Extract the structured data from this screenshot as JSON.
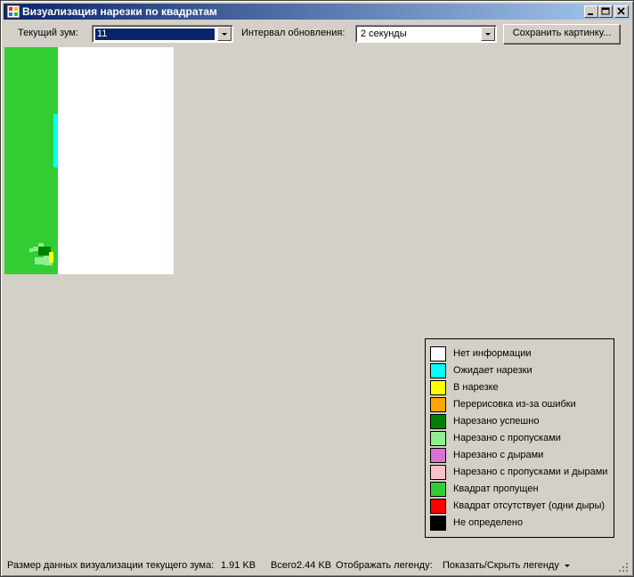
{
  "window": {
    "title": "Визуализация нарезки по квадратам"
  },
  "toolbar": {
    "zoom_label": "Текущий зум:",
    "zoom_value": "11",
    "interval_label": "Интервал обновления:",
    "interval_value": "2 секунды",
    "save_button": "Сохранить картинку..."
  },
  "legend": {
    "items": [
      {
        "label": "Нет информации",
        "color": "#ffffff"
      },
      {
        "label": "Ожидает нарезки",
        "color": "#00ffff"
      },
      {
        "label": "В нарезке",
        "color": "#ffff00"
      },
      {
        "label": "Перерисовка из-за ошибки",
        "color": "#ffa500"
      },
      {
        "label": "Нарезано успешно",
        "color": "#008000"
      },
      {
        "label": "Нарезано с пропусками",
        "color": "#90ee90"
      },
      {
        "label": "Нарезано с дырами",
        "color": "#da70d6"
      },
      {
        "label": "Нарезано с пропусками и дырами",
        "color": "#ffc0cb"
      },
      {
        "label": "Квадрат пропущен",
        "color": "#32cd32"
      },
      {
        "label": "Квадрат отсутствует (одни дыры)",
        "color": "#ff0000"
      },
      {
        "label": "Не определено",
        "color": "#000000"
      }
    ]
  },
  "status": {
    "size_label": "Размер данных визуализации текущего зума:",
    "size_value": "1.91 KB",
    "total_label": "Всего:",
    "total_value": "2.44 KB",
    "legend_label": "Отображать легенду:",
    "legend_toggle": "Показать/Скрыть легенду"
  }
}
